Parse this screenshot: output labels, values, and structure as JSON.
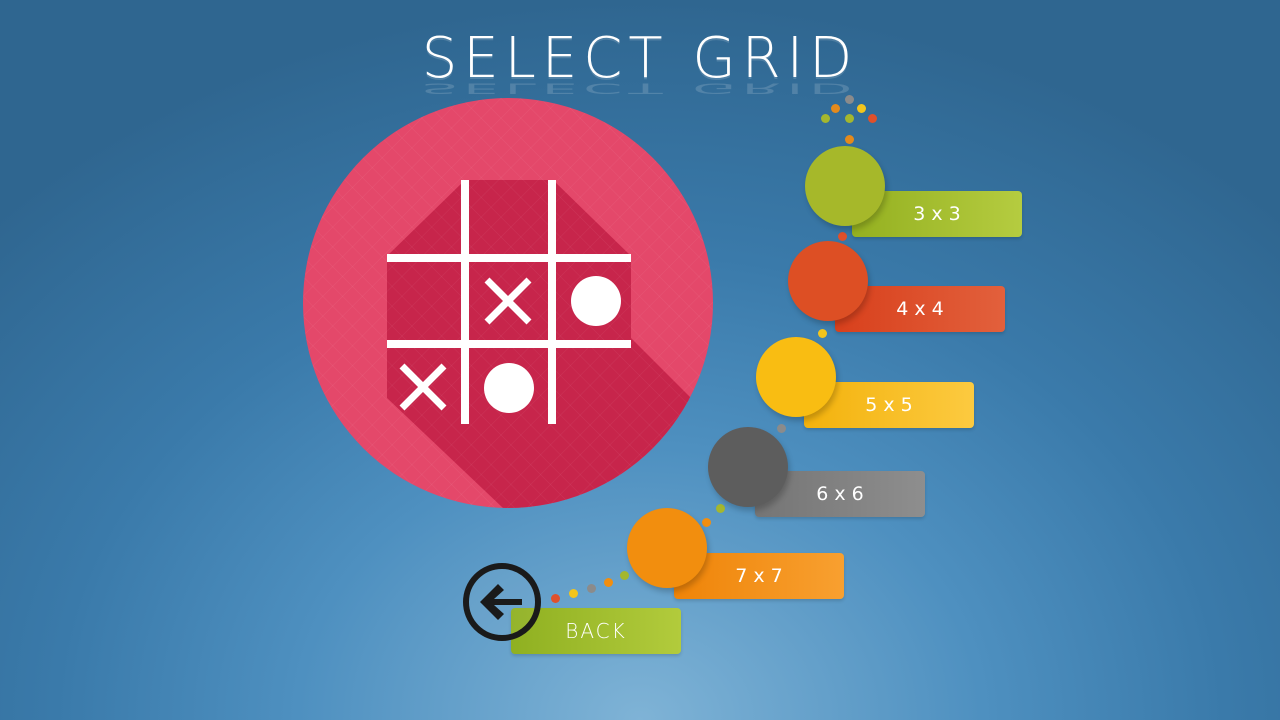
{
  "title": "SELECT GRID",
  "grid_options": [
    {
      "label": "3 x 3",
      "color": "#a6b82a",
      "bar_from": "#94b020",
      "bar_to": "#b5cc40"
    },
    {
      "label": "4 x 4",
      "color": "#dd4f24",
      "bar_from": "#d8401c",
      "bar_to": "#e2603c"
    },
    {
      "label": "5 x 5",
      "color": "#f9bd12",
      "bar_from": "#f3b20c",
      "bar_to": "#fcca40"
    },
    {
      "label": "6 x 6",
      "color": "#5d5d5d",
      "bar_from": "#757575",
      "bar_to": "#8e8e8e"
    },
    {
      "label": "7 x 7",
      "color": "#f28e0e",
      "bar_from": "#ef8408",
      "bar_to": "#f8a030"
    }
  ],
  "back": {
    "label": "BACK"
  },
  "colors": {
    "logo_red": "#e4486a",
    "logo_shadow": "#c7254b"
  },
  "icons": {
    "logo": "tic-tac-toe-icon",
    "back": "back-arrow-icon"
  }
}
